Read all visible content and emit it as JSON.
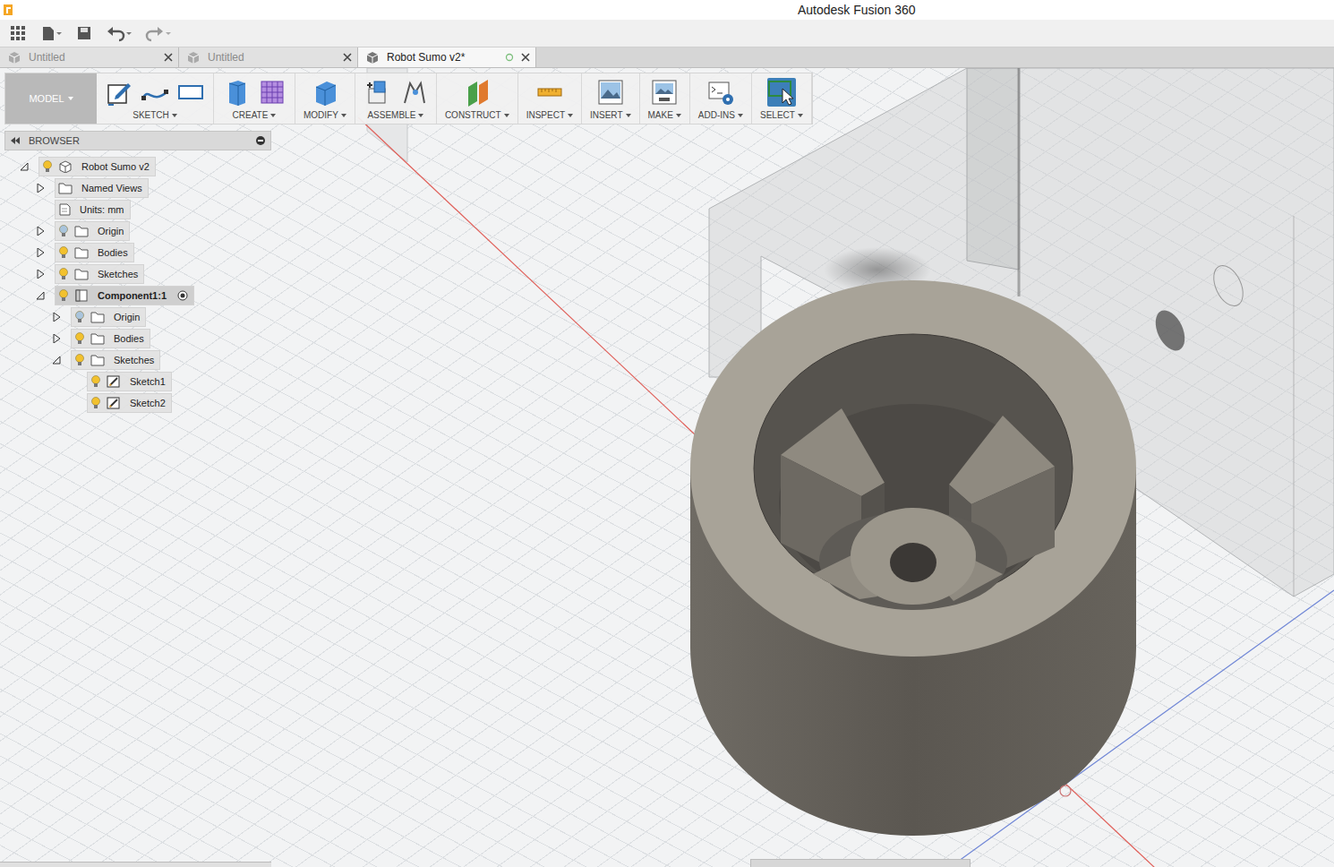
{
  "window": {
    "title": "Autodesk Fusion 360"
  },
  "doc_tabs": [
    {
      "label": "Untitled",
      "selected": false
    },
    {
      "label": "Untitled",
      "selected": false
    },
    {
      "label": "Robot Sumo v2*",
      "selected": true
    }
  ],
  "workspace": {
    "label": "MODEL"
  },
  "toolbar": [
    {
      "label": "SKETCH",
      "selected": false
    },
    {
      "label": "CREATE",
      "selected": false
    },
    {
      "label": "MODIFY",
      "selected": false
    },
    {
      "label": "ASSEMBLE",
      "selected": false
    },
    {
      "label": "CONSTRUCT",
      "selected": false
    },
    {
      "label": "INSPECT",
      "selected": false
    },
    {
      "label": "INSERT",
      "selected": false
    },
    {
      "label": "MAKE",
      "selected": false
    },
    {
      "label": "ADD-INS",
      "selected": false
    },
    {
      "label": "SELECT",
      "selected": true
    }
  ],
  "browser": {
    "title": "BROWSER",
    "items": [
      {
        "label": "Robot Sumo v2",
        "level": 0,
        "kind": "root",
        "expanded": true,
        "visible": true
      },
      {
        "label": "Named Views",
        "level": 1,
        "kind": "folder",
        "expanded": false
      },
      {
        "label": "Units: mm",
        "level": 1,
        "kind": "units"
      },
      {
        "label": "Origin",
        "level": 1,
        "kind": "folder",
        "expanded": false,
        "visible": false
      },
      {
        "label": "Bodies",
        "level": 1,
        "kind": "folder",
        "expanded": false,
        "visible": true
      },
      {
        "label": "Sketches",
        "level": 1,
        "kind": "folder",
        "expanded": false,
        "visible": true
      },
      {
        "label": "Component1:1",
        "level": 1,
        "kind": "component",
        "expanded": true,
        "visible": true,
        "active": true
      },
      {
        "label": "Origin",
        "level": 2,
        "kind": "folder",
        "expanded": false,
        "visible": false
      },
      {
        "label": "Bodies",
        "level": 2,
        "kind": "folder",
        "expanded": false,
        "visible": true
      },
      {
        "label": "Sketches",
        "level": 2,
        "kind": "folder",
        "expanded": true,
        "visible": true
      },
      {
        "label": "Sketch1",
        "level": 3,
        "kind": "sketch",
        "visible": true
      },
      {
        "label": "Sketch2",
        "level": 3,
        "kind": "sketch",
        "visible": true
      }
    ]
  }
}
